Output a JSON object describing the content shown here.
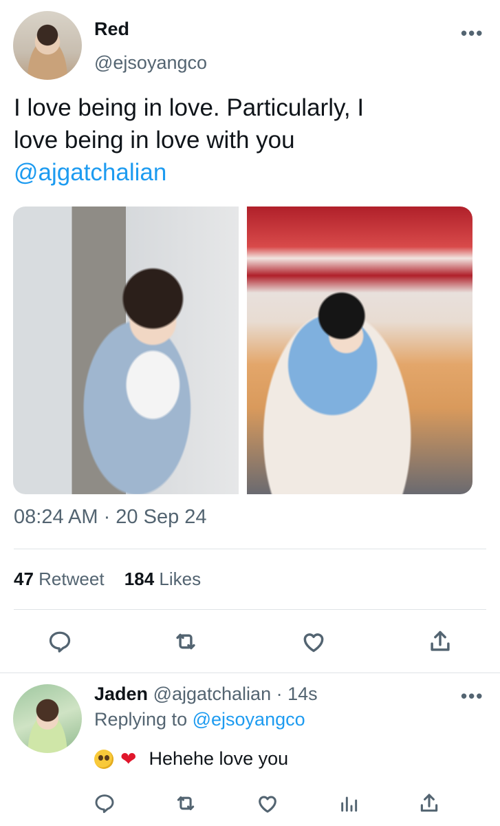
{
  "tweet": {
    "author_name": "Red",
    "author_handle": "@ejsoyangco",
    "more_label": "•••",
    "text_line1": "I love being in love. Particularly, I",
    "text_line2": "love being in love with you",
    "text_mention": "@ajgatchalian",
    "timestamp": "08:24 AM · 20 Sep 24",
    "retweet_count": "47",
    "retweet_label": "Retweet",
    "like_count": "184",
    "like_label": "Likes",
    "actions": [
      "reply-icon",
      "retweet-icon",
      "heart-icon",
      "share-icon"
    ]
  },
  "reply": {
    "author_name": "Jaden",
    "author_handle": "@ajgatchalian",
    "time": "· 14s",
    "replying_prefix": "Replying to",
    "replying_handle": "@ejsoyangco",
    "emoji_heart": "❤",
    "text": "Hehehe love you",
    "more_label": "•••",
    "actions": [
      "reply-icon",
      "retweet-icon",
      "heart-icon",
      "analytics-icon",
      "share-icon"
    ]
  },
  "colors": {
    "accent": "#1d9bf0",
    "secondary_text": "#536471",
    "primary_text": "#0f1419",
    "divider": "#dfe3e6",
    "heart_emoji": "#e0162b"
  }
}
